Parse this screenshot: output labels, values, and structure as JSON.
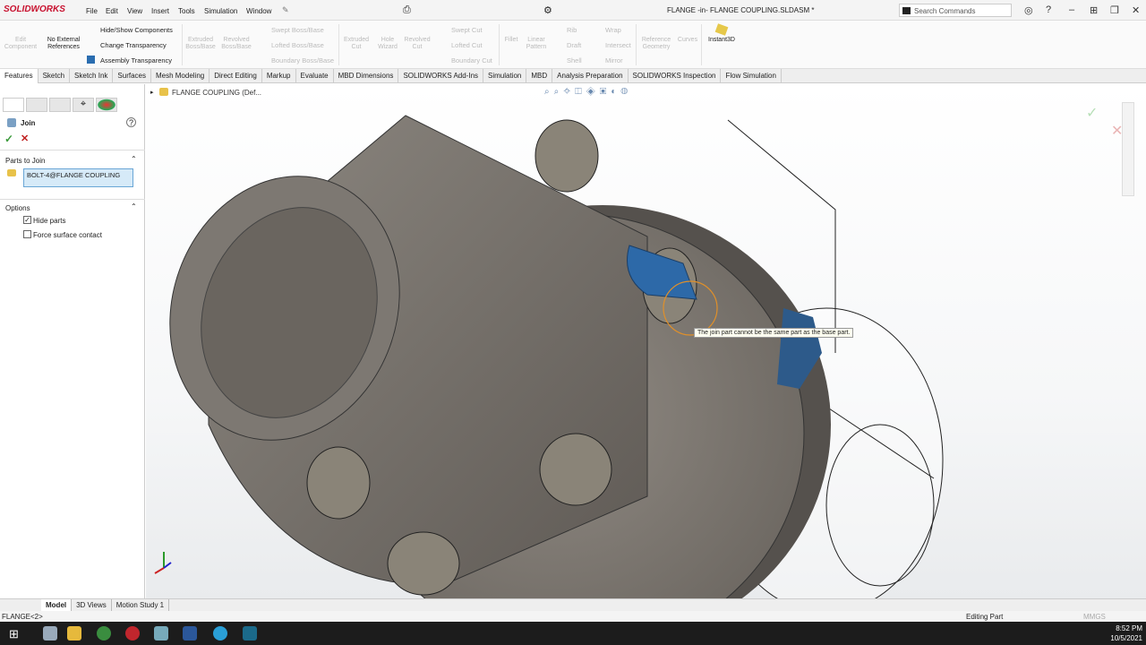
{
  "app": {
    "logo": "SOLIDWORKS",
    "title": "FLANGE -in- FLANGE COUPLING.SLDASM *",
    "search_placeholder": "Search Commands"
  },
  "menu": [
    "File",
    "Edit",
    "View",
    "Insert",
    "Tools",
    "Simulation",
    "Window"
  ],
  "ribbon": {
    "edit_component": "Edit Component",
    "no_external": "No External References",
    "hide_show": "Hide/Show Components",
    "change_transparency": "Change Transparency",
    "assembly_transparency": "Assembly Transparency",
    "extruded_boss": "Extruded Boss/Base",
    "revolved_boss": "Revolved Boss/Base",
    "swept_boss": "Swept Boss/Base",
    "lofted_boss": "Lofted Boss/Base",
    "boundary_boss": "Boundary Boss/Base",
    "extruded_cut": "Extruded Cut",
    "hole_wizard": "Hole Wizard",
    "revolved_cut": "Revolved Cut",
    "swept_cut": "Swept Cut",
    "lofted_cut": "Lofted Cut",
    "boundary_cut": "Boundary Cut",
    "fillet": "Fillet",
    "linear_pattern": "Linear Pattern",
    "rib": "Rib",
    "draft": "Draft",
    "shell": "Shell",
    "wrap": "Wrap",
    "intersect": "Intersect",
    "mirror": "Mirror",
    "reference_geometry": "Reference Geometry",
    "curves": "Curves",
    "instant3d": "Instant3D"
  },
  "tabs": [
    "Features",
    "Sketch",
    "Sketch Ink",
    "Surfaces",
    "Mesh Modeling",
    "Direct Editing",
    "Markup",
    "Evaluate",
    "MBD Dimensions",
    "SOLIDWORKS Add-Ins",
    "Simulation",
    "MBD",
    "Analysis Preparation",
    "SOLIDWORKS Inspection",
    "Flow Simulation"
  ],
  "panel": {
    "title": "Join",
    "parts_header": "Parts to Join",
    "parts_value": "BOLT-4@FLANGE COUPLING",
    "options_header": "Options",
    "hide_parts": "Hide parts",
    "hide_parts_checked": true,
    "force_contact": "Force surface contact",
    "force_contact_checked": false
  },
  "tree": {
    "root": "FLANGE COUPLING  (Def..."
  },
  "tooltip": "The join part cannot be the same part as the base part.",
  "bottom_tabs": [
    "Model",
    "3D Views",
    "Motion Study 1"
  ],
  "status": {
    "left": "FLANGE<2>",
    "mode": "Editing Part",
    "units": "MMGS"
  },
  "taskbar": {
    "time": "8:52 PM",
    "date": "10/5/2021"
  }
}
